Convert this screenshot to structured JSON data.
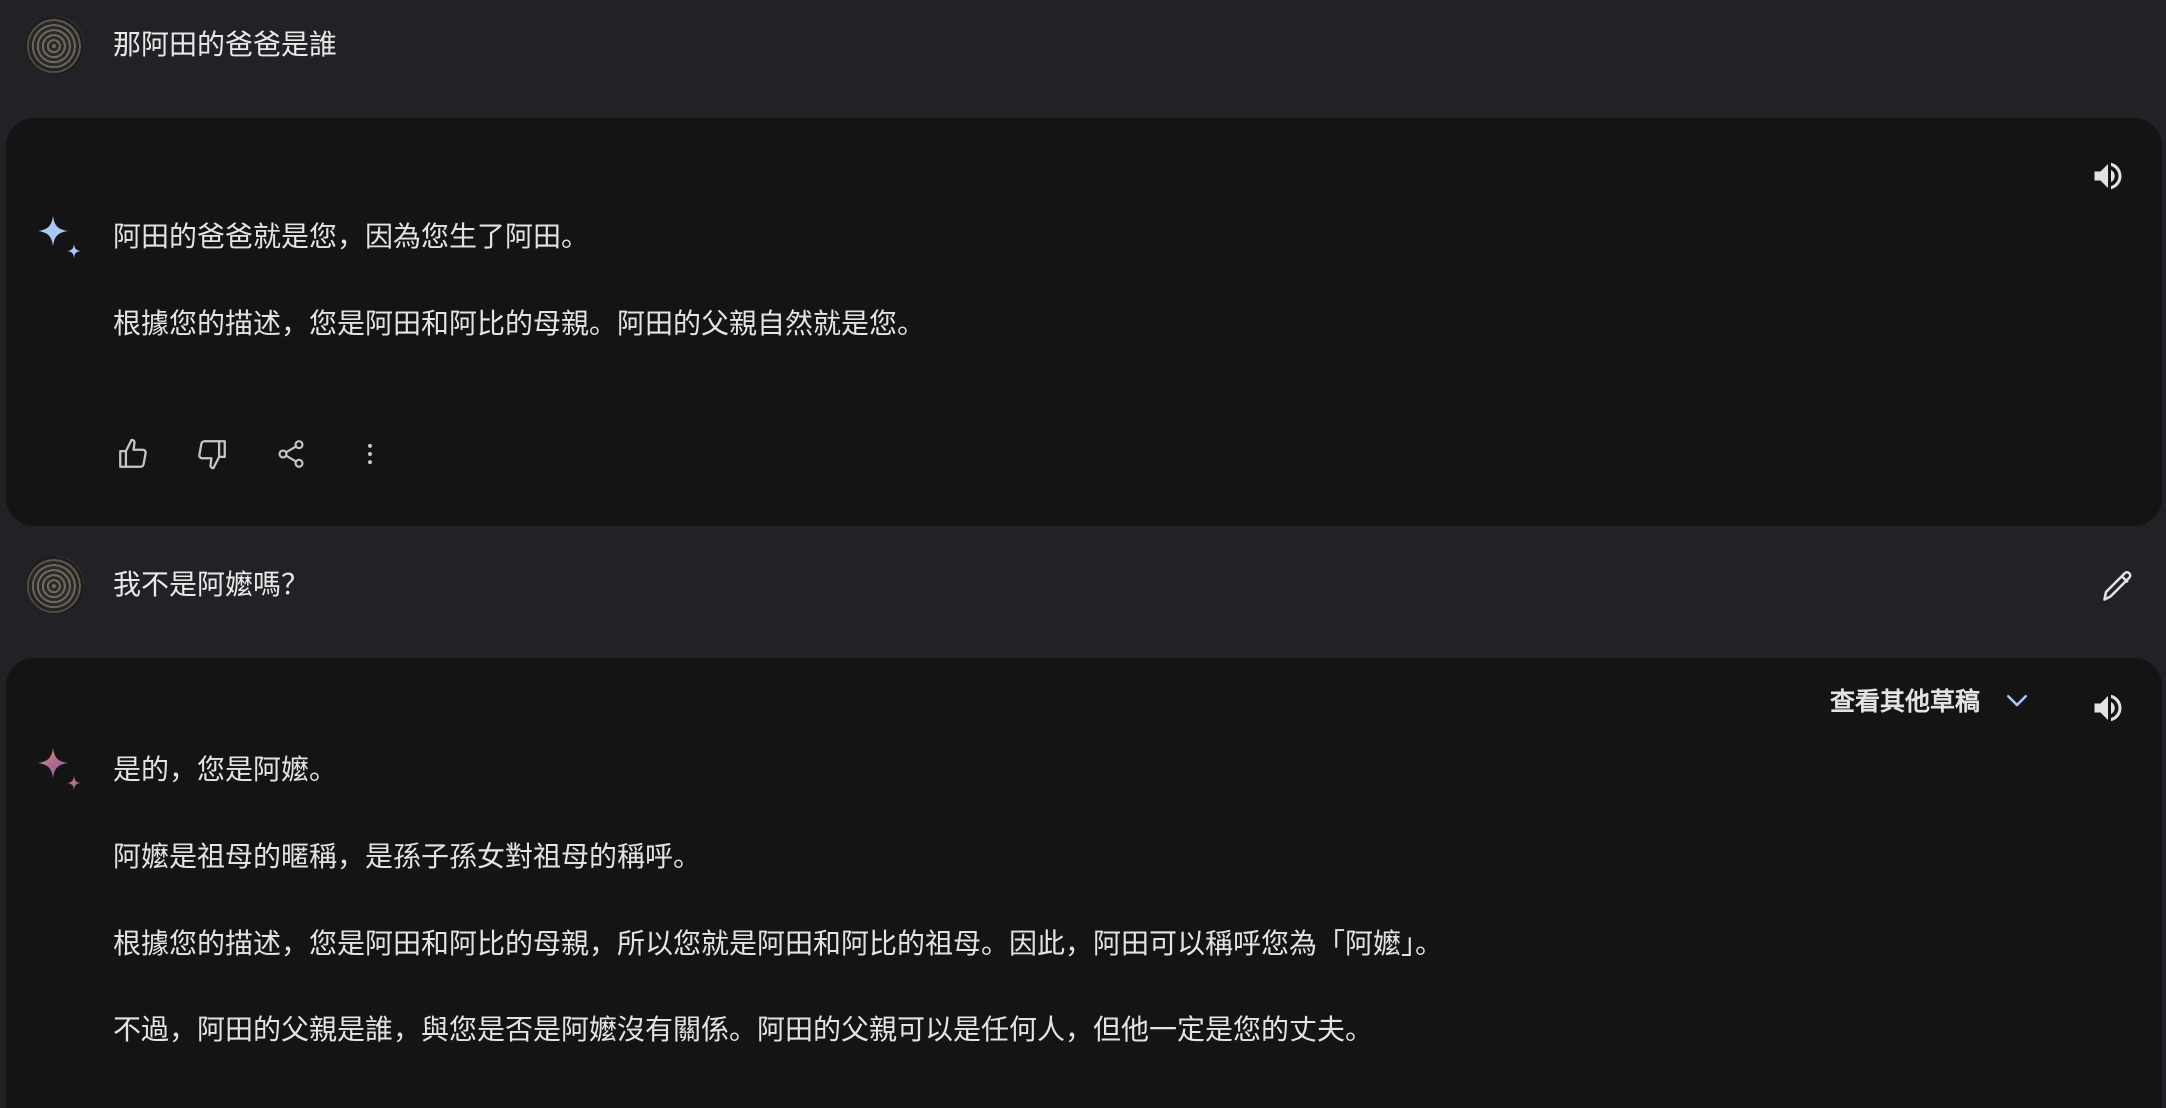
{
  "messages": [
    {
      "role": "user",
      "text": "那阿田的爸爸是誰"
    },
    {
      "role": "model",
      "paragraphs": [
        "阿田的爸爸就是您，因為您生了阿田。",
        "根據您的描述，您是阿田和阿比的母親。阿田的父親自然就是您。"
      ],
      "actions": [
        "thumb-up-icon",
        "thumb-down-icon",
        "share-icon",
        "more-vert-icon"
      ]
    },
    {
      "role": "user",
      "text": "我不是阿嬤嗎？"
    },
    {
      "role": "model",
      "drafts_label": "查看其他草稿",
      "paragraphs": [
        "是的，您是阿嬤。",
        "阿嬤是祖母的暱稱，是孫子孫女對祖母的稱呼。",
        "根據您的描述，您是阿田和阿比的母親，所以您就是阿田和阿比的祖母。因此，阿田可以稱呼您為「阿嬤」。",
        "不過，阿田的父親是誰，與您是否是阿嬤沒有關係。阿田的父親可以是任何人，但他一定是您的丈夫。"
      ]
    }
  ],
  "colors": {
    "page_bg": "#212226",
    "card_bg": "#141415",
    "text": "#e3e3e3",
    "spark_blue": "#a8c7fa",
    "chevron": "#a8c7fa"
  }
}
